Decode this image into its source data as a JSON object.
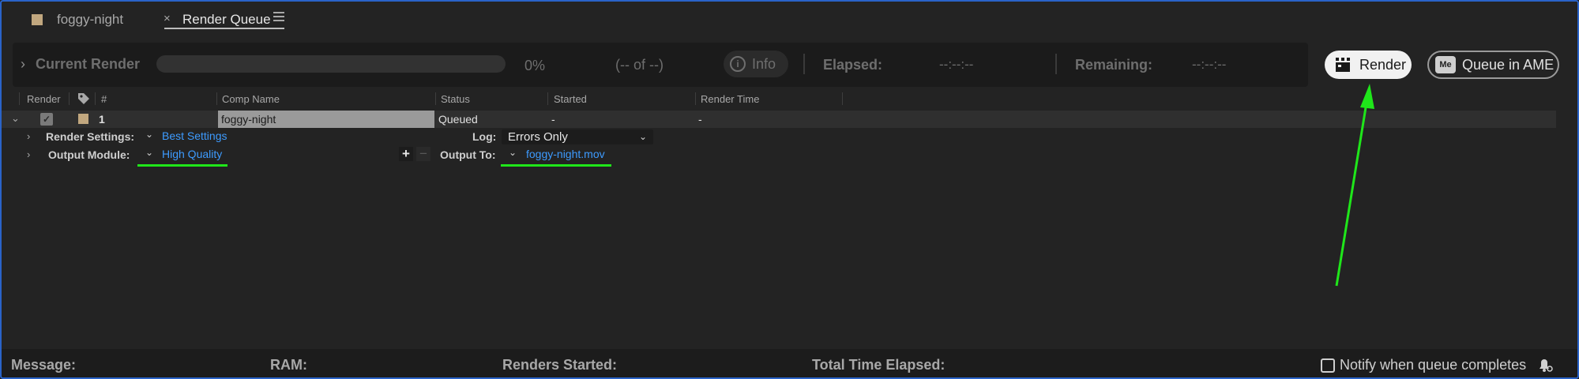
{
  "tabs": [
    {
      "label": "foggy-night",
      "active": false
    },
    {
      "label": "Render Queue",
      "active": true
    }
  ],
  "current_render": {
    "label": "Current Render",
    "progress_percent": 0,
    "percent_text": "0%",
    "of_text": "(-- of --)",
    "info_label": "Info",
    "elapsed_label": "Elapsed:",
    "elapsed_value": "--:--:--",
    "remaining_label": "Remaining:",
    "remaining_value": "--:--:--"
  },
  "buttons": {
    "render": "Render",
    "queue_ame": "Queue in AME",
    "ame_icon_text": "Me"
  },
  "table": {
    "headers": {
      "render": "Render",
      "num": "#",
      "comp_name": "Comp Name",
      "status": "Status",
      "started": "Started",
      "render_time": "Render Time"
    },
    "rows": [
      {
        "num": "1",
        "comp_name": "foggy-night",
        "status": "Queued",
        "started": "-",
        "render_time": "-",
        "checked": true,
        "label_color": "#c1a77f"
      }
    ]
  },
  "item": {
    "render_settings_label": "Render Settings:",
    "render_settings_value": "Best Settings",
    "log_label": "Log:",
    "log_value": "Errors Only",
    "output_module_label": "Output Module:",
    "output_module_value": "High Quality",
    "output_to_label": "Output To:",
    "output_to_value": "foggy-night.mov"
  },
  "footer": {
    "message_label": "Message:",
    "ram_label": "RAM:",
    "renders_started_label": "Renders Started:",
    "total_time_label": "Total Time Elapsed:",
    "notify_label": "Notify when queue completes",
    "notify_checked": false
  },
  "colors": {
    "link": "#3d9bff",
    "annotation": "#1fe61a",
    "frame_border": "#2a63c8"
  }
}
